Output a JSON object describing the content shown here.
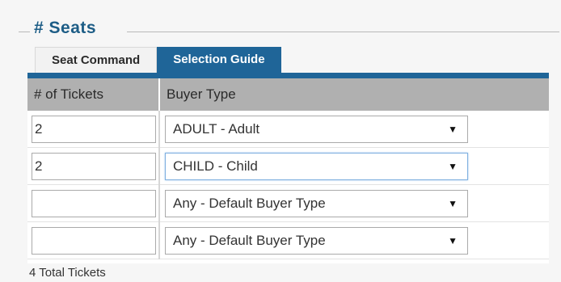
{
  "legend": "# Seats",
  "tabs": [
    {
      "label": "Seat Command",
      "active": false
    },
    {
      "label": "Selection Guide",
      "active": true
    }
  ],
  "table": {
    "headers": [
      "# of Tickets",
      "Buyer Type"
    ],
    "rows": [
      {
        "qty": "2",
        "buyer_type": "ADULT - Adult"
      },
      {
        "qty": "2",
        "buyer_type": "CHILD - Child"
      },
      {
        "qty": "",
        "buyer_type": "Any - Default Buyer Type"
      },
      {
        "qty": "",
        "buyer_type": "Any - Default Buyer Type"
      }
    ]
  },
  "dropdown_arrow": "▼",
  "total": "4 Total Tickets",
  "colors": {
    "accent": "#1f6598",
    "legend_text": "#1d5d86",
    "header_bg": "#b0b0b0",
    "page_bg": "#f6f6f6"
  }
}
